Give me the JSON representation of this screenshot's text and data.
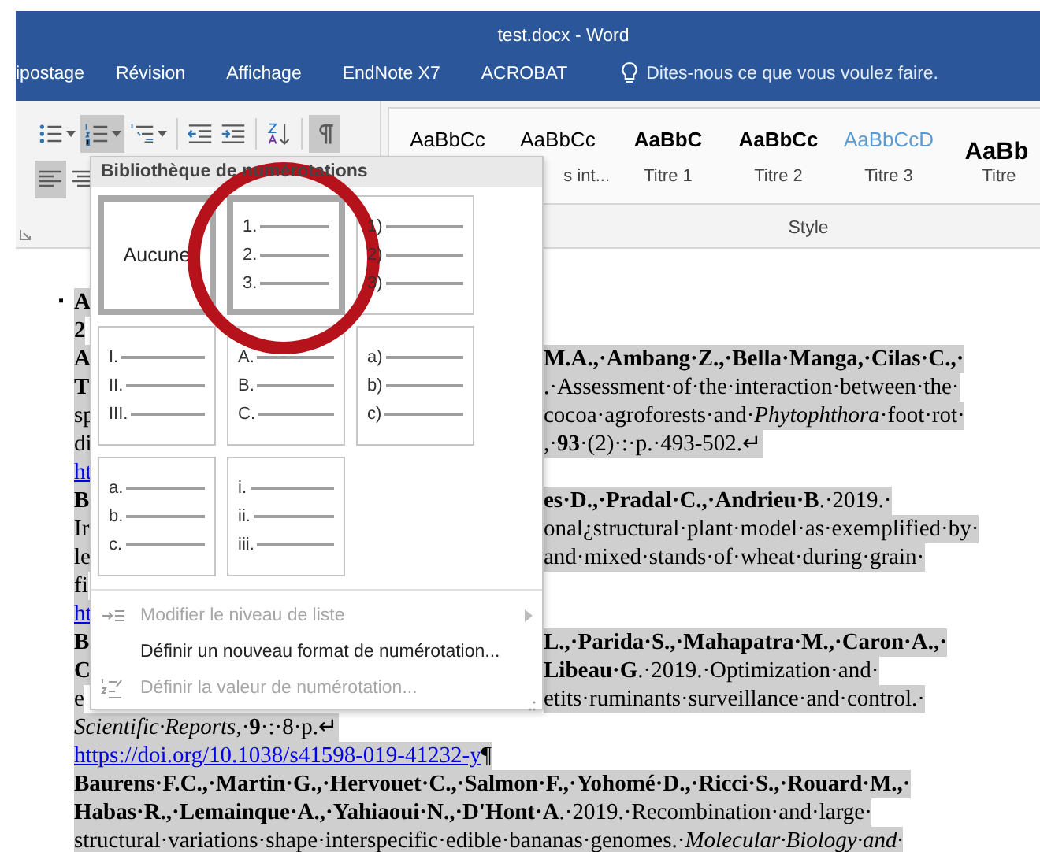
{
  "window": {
    "title": "test.docx - Word"
  },
  "ribbon_tabs": [
    {
      "label": "ipostage"
    },
    {
      "label": "Révision"
    },
    {
      "label": "Affichage"
    },
    {
      "label": "EndNote X7"
    },
    {
      "label": "ACROBAT"
    }
  ],
  "tell_me": {
    "placeholder": "Dites-nous ce que vous voulez faire."
  },
  "paragraph_tools": [
    {
      "kind": "bullets",
      "pressed": false,
      "dropdown": true
    },
    {
      "kind": "numbering",
      "pressed": true,
      "dropdown": true
    },
    {
      "kind": "multilevel",
      "pressed": false,
      "dropdown": true
    },
    {
      "kind": "outdent",
      "pressed": false,
      "dropdown": false
    },
    {
      "kind": "indent",
      "pressed": false,
      "dropdown": false
    },
    {
      "kind": "sort",
      "pressed": false,
      "dropdown": false
    },
    {
      "kind": "pilcrow",
      "pressed": true,
      "dropdown": false
    }
  ],
  "align_tools": [
    {
      "kind": "align-left",
      "pressed": true
    },
    {
      "kind": "align-center",
      "pressed": false
    }
  ],
  "styles": {
    "group_label": "Style",
    "items": [
      {
        "sample": "AaBbCc",
        "kind": "normal"
      },
      {
        "sample": "AaBbCc",
        "kind": "normal",
        "label": "s int..."
      },
      {
        "sample": "AaBbC",
        "kind": "heading1",
        "label": "Titre 1"
      },
      {
        "sample": "AaBbCc",
        "kind": "heading2",
        "label": "Titre 2"
      },
      {
        "sample": "AaBbCcD",
        "kind": "heading3",
        "label": "Titre 3"
      },
      {
        "sample": "AaBb",
        "kind": "title",
        "label": "Titre"
      }
    ]
  },
  "document": {
    "lines": [
      {
        "kind": "split",
        "marker": "▪",
        "left": "**A**"
      },
      {
        "kind": "split",
        "left": "**2**"
      },
      {
        "kind": "split",
        "left": "**A**",
        "right": "**M.A.,·Ambang·Z.,·Bella·Manga,·Cilas·C.,·**"
      },
      {
        "kind": "split",
        "left": "**T**",
        "right": ".·Assessment·of·the·interaction·between·the·"
      },
      {
        "kind": "split",
        "left": "sp",
        "right": "cocoa·agroforests·and·*Phytophthora*·foot·rot·"
      },
      {
        "kind": "split",
        "left": "di",
        "right": ",·**93**·(2)·:·p.·493-502.↵"
      },
      {
        "kind": "split",
        "left": "ht",
        "left_link": true
      },
      {
        "kind": "split",
        "left": "**B**",
        "right": "**es·D.,·Pradal·C.,·Andrieu·B**.·2019.·"
      },
      {
        "kind": "split",
        "left": "Ir",
        "right": "onal¿structural·plant·model·as·exemplified·by·"
      },
      {
        "kind": "split",
        "left": "le",
        "right": "and·mixed·stands·of·wheat·during·grain·"
      },
      {
        "kind": "split",
        "left": "fi"
      },
      {
        "kind": "split",
        "left": "ht",
        "left_link": true
      },
      {
        "kind": "split",
        "left": "**B**",
        "right": "**L.,·Parida·S.,·Mahapatra·M.,·Caron·A.,·**"
      },
      {
        "kind": "split",
        "left": "**C**",
        "right": "**Libeau·G**.·2019.·Optimization·and·"
      },
      {
        "kind": "split",
        "left": "e",
        "right": "etits·ruminants·surveillance·and·control.·"
      },
      {
        "kind": "text",
        "text": "*Scientific·Reports*,·**9**·:·8·p.↵"
      },
      {
        "kind": "link",
        "link": "https://doi.org/10.1038/s41598-019-41232-y",
        "mark": "¶"
      },
      {
        "kind": "text",
        "text": "**Baurens·F.C.,·Martin·G.,·Hervouet·C.,·Salmon·F.,·Yohomé·D.,·Ricci·S.,·Rouard·M.,·**"
      },
      {
        "kind": "text",
        "text": "**Habas·R.,·Lemainque·A.,·Yahiaoui·N.,·D'Hont·A**.·2019.·Recombination·and·large·"
      },
      {
        "kind": "text",
        "text": "structural·variations·shape·interspecific·edible·bananas·genomes.·*Molecular·Biology·and·*"
      }
    ]
  },
  "numbering_menu": {
    "title": "Bibliothèque de numérotations",
    "formats": [
      {
        "kind": "none",
        "label": "Aucune",
        "selected": true
      },
      {
        "kind": "list",
        "markers": [
          "1.",
          "2.",
          "3."
        ],
        "selected": true
      },
      {
        "kind": "list",
        "markers": [
          "1)",
          "2)",
          "3)"
        ],
        "selected": false
      },
      {
        "kind": "list",
        "markers": [
          "I.",
          "II.",
          "III."
        ],
        "selected": false
      },
      {
        "kind": "list",
        "markers": [
          "A.",
          "B.",
          "C."
        ],
        "selected": false
      },
      {
        "kind": "list",
        "markers": [
          "a)",
          "b)",
          "c)"
        ],
        "selected": false
      },
      {
        "kind": "list",
        "markers": [
          "a.",
          "b.",
          "c."
        ],
        "selected": false
      },
      {
        "kind": "list",
        "markers": [
          "i.",
          "ii.",
          "iii."
        ],
        "selected": false
      }
    ],
    "commands": [
      {
        "label": "Modifier le niveau de liste",
        "kind": "level",
        "disabled": true,
        "submenu": true
      },
      {
        "label": "Définir un nouveau format de numérotation...",
        "kind": "define",
        "disabled": false,
        "submenu": false
      },
      {
        "label": "Définir la valeur de numérotation...",
        "kind": "value",
        "disabled": true,
        "submenu": false
      }
    ]
  },
  "annotation": {
    "kind": "circle"
  }
}
